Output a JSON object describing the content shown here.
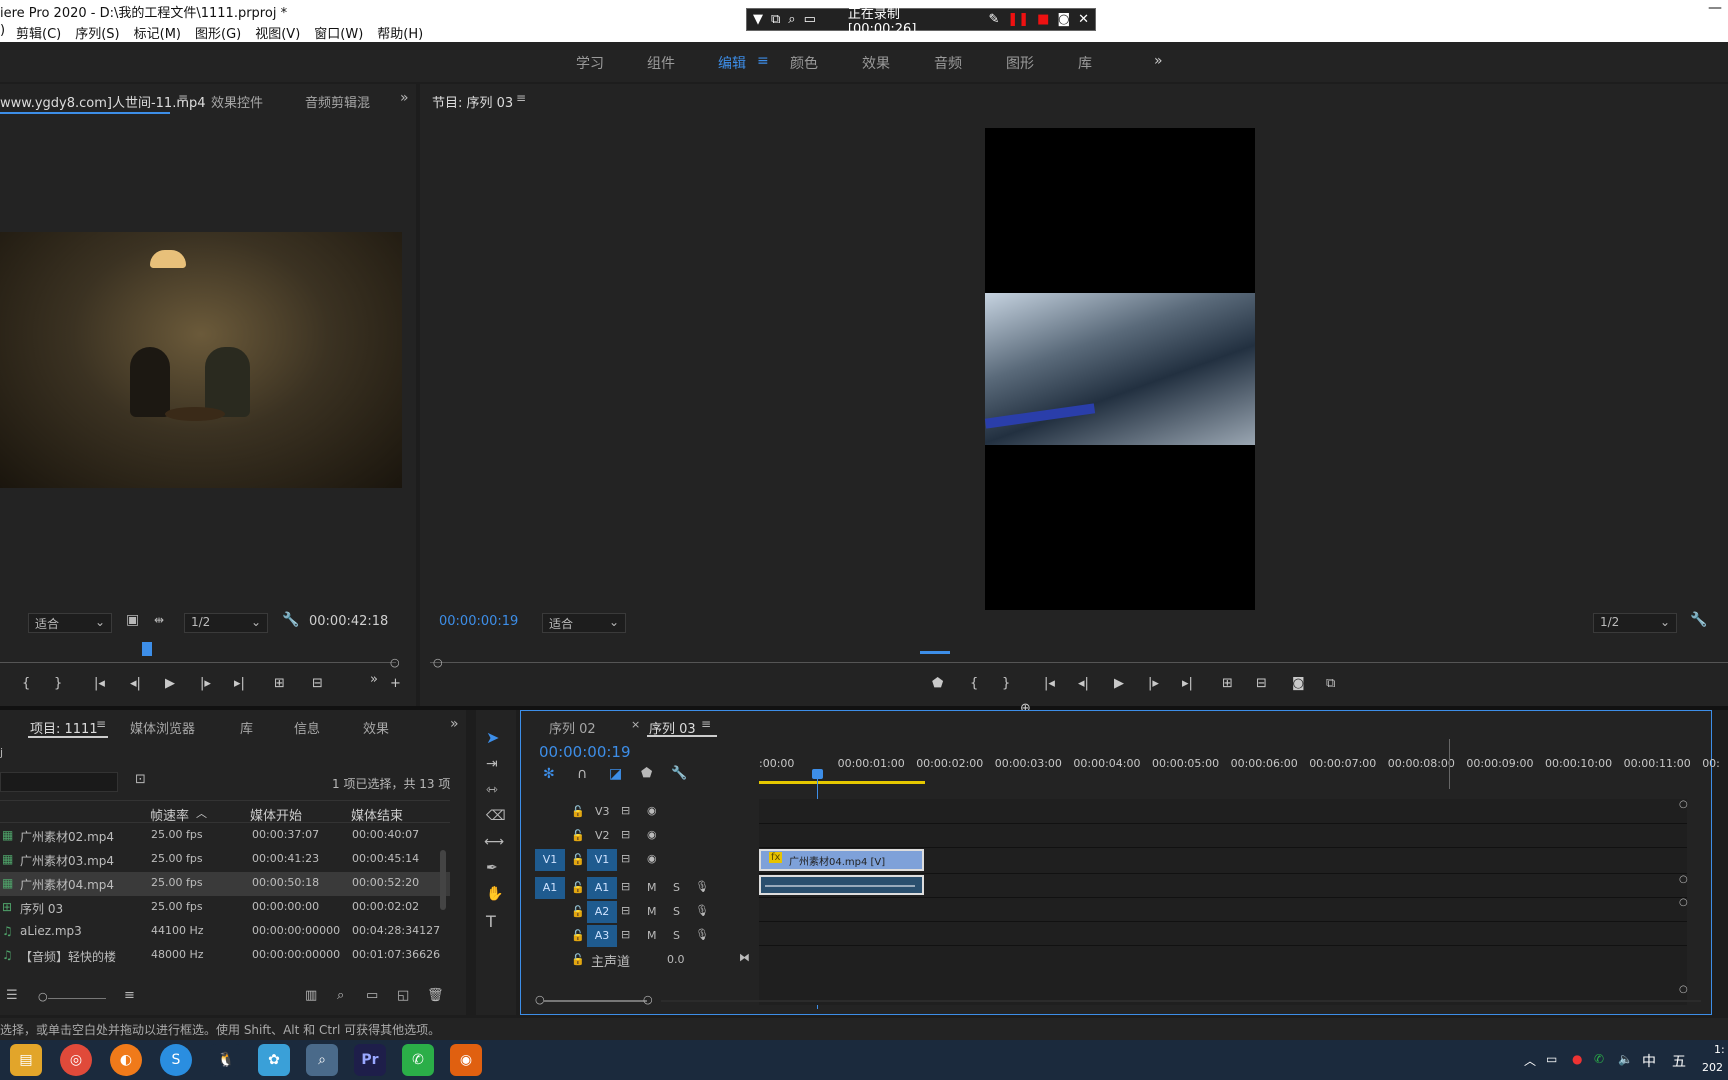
{
  "app": {
    "title": "iere Pro 2020 - D:\\我的工程文件\\1111.prproj *"
  },
  "menu": [
    "剪辑(C)",
    "序列(S)",
    "标记(M)",
    "图形(G)",
    "视图(V)",
    "窗口(W)",
    "帮助(H)"
  ],
  "recorder": {
    "status": "正在录制 [00:00:26]"
  },
  "workspaces": {
    "tabs": [
      "学习",
      "组件",
      "编辑",
      "颜色",
      "效果",
      "音频",
      "图形",
      "库"
    ],
    "active": "编辑"
  },
  "source": {
    "tab1": "www.ygdy8.com]人世间-11.mp4",
    "tab2": "效果控件",
    "tab3": "音频剪辑混",
    "fit": "适合",
    "res": "1/2",
    "timecode": "00:00:42:18"
  },
  "program": {
    "title": "节目: 序列 03",
    "timecode": "00:00:00:19",
    "fit": "适合",
    "res": "1/2"
  },
  "project": {
    "tabs": [
      "项目: 1111",
      "媒体浏览器",
      "库",
      "信息",
      "效果"
    ],
    "sel_count": "1 项已选择，共 13 项",
    "path": "j",
    "headers": [
      "帧速率",
      "媒体开始",
      "媒体结束"
    ],
    "rows": [
      {
        "name": "广州素材02.mp4",
        "fps": "25.00 fps",
        "start": "00:00:37:07",
        "end": "00:00:40:07"
      },
      {
        "name": "广州素材03.mp4",
        "fps": "25.00 fps",
        "start": "00:00:41:23",
        "end": "00:00:45:14"
      },
      {
        "name": "广州素材04.mp4",
        "fps": "25.00 fps",
        "start": "00:00:50:18",
        "end": "00:00:52:20"
      },
      {
        "name": "序列 03",
        "fps": "25.00 fps",
        "start": "00:00:00:00",
        "end": "00:00:02:02"
      },
      {
        "name": "aLiez.mp3",
        "fps": "44100 Hz",
        "start": "00:00:00:00000",
        "end": "00:04:28:34127"
      },
      {
        "name": "【音频】轻快的楼",
        "fps": "48000 Hz",
        "start": "00:00:00:00000",
        "end": "00:01:07:36626"
      }
    ]
  },
  "timeline": {
    "tabs": [
      "序列 02",
      "序列 03"
    ],
    "timecode": "00:00:00:19",
    "ruler": [
      ":00:00",
      "00:00:01:00",
      "00:00:02:00",
      "00:00:03:00",
      "00:00:04:00",
      "00:00:05:00",
      "00:00:06:00",
      "00:00:07:00",
      "00:00:08:00",
      "00:00:09:00",
      "00:00:10:00",
      "00:00:11:00",
      "00:"
    ],
    "tracks": {
      "v3": "V3",
      "v2": "V2",
      "v1": "V1",
      "a1": "A1",
      "a2": "A2",
      "a3": "A3",
      "src_v": "V1",
      "src_a": "A1"
    },
    "mix": {
      "label": "主声道",
      "value": "0.0"
    },
    "clip_v": "广州素材04.mp4 [V]",
    "fx": "fx",
    "m": "M",
    "s": "S"
  },
  "status": {
    "text": "选择，或单击空白处并拖动以进行框选。使用 Shift、Alt 和 Ctrl 可获得其他选项。"
  },
  "tray": {
    "ime1": "中",
    "ime2": "五",
    "time": "1:",
    "date": "202"
  }
}
